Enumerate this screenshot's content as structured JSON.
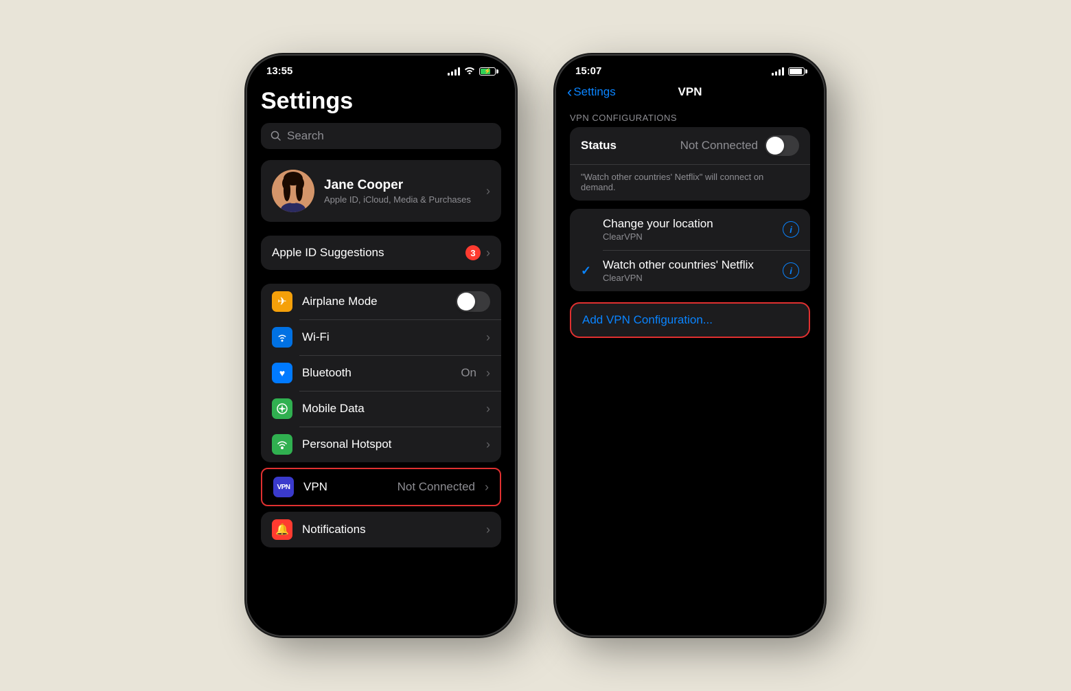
{
  "page": {
    "background": "#e8e4d8"
  },
  "phone1": {
    "time": "13:55",
    "title": "Settings",
    "search_placeholder": "Search",
    "profile": {
      "name": "Jane Cooper",
      "subtitle": "Apple ID, iCloud, Media & Purchases"
    },
    "apple_id_suggestion": {
      "label": "Apple ID Suggestions",
      "badge": "3"
    },
    "rows": [
      {
        "icon_bg": "#f5a00a",
        "icon": "✈",
        "label": "Airplane Mode",
        "value": "",
        "has_toggle": true,
        "toggle_on": false
      },
      {
        "icon_bg": "#0071e3",
        "icon": "📶",
        "label": "Wi-Fi",
        "value": "",
        "has_chevron": true
      },
      {
        "icon_bg": "#007aff",
        "icon": "🔵",
        "label": "Bluetooth",
        "value": "On",
        "has_chevron": true
      },
      {
        "icon_bg": "#30b050",
        "icon": "📡",
        "label": "Mobile Data",
        "value": "",
        "has_chevron": true
      },
      {
        "icon_bg": "#30b050",
        "icon": "🔗",
        "label": "Personal Hotspot",
        "value": "",
        "has_chevron": true
      }
    ],
    "vpn_row": {
      "label": "VPN",
      "value": "Not Connected",
      "highlighted": true
    },
    "notifications_row": {
      "icon_bg": "#ff3b30",
      "icon": "🔔",
      "label": "Notifications"
    }
  },
  "phone2": {
    "time": "15:07",
    "nav_back": "Settings",
    "title": "VPN",
    "section_header": "VPN CONFIGURATIONS",
    "status_row": {
      "label": "Status",
      "value": "Not Connected",
      "toggle_on": false
    },
    "vpn_note": "\"Watch other countries' Netflix\" will connect on demand.",
    "configs": [
      {
        "name": "Change your location",
        "provider": "ClearVPN",
        "checked": false
      },
      {
        "name": "Watch other countries' Netflix",
        "provider": "ClearVPN",
        "checked": true
      }
    ],
    "add_button_label": "Add VPN Configuration..."
  },
  "icons": {
    "search": "🔍",
    "chevron": "›",
    "back_chevron": "‹",
    "checkmark": "✓",
    "info": "i",
    "airplane": "✈",
    "wifi": "wifi",
    "bluetooth": "B",
    "cellular": "C",
    "hotspot": "H",
    "vpn": "VPN",
    "bell": "🔔"
  }
}
